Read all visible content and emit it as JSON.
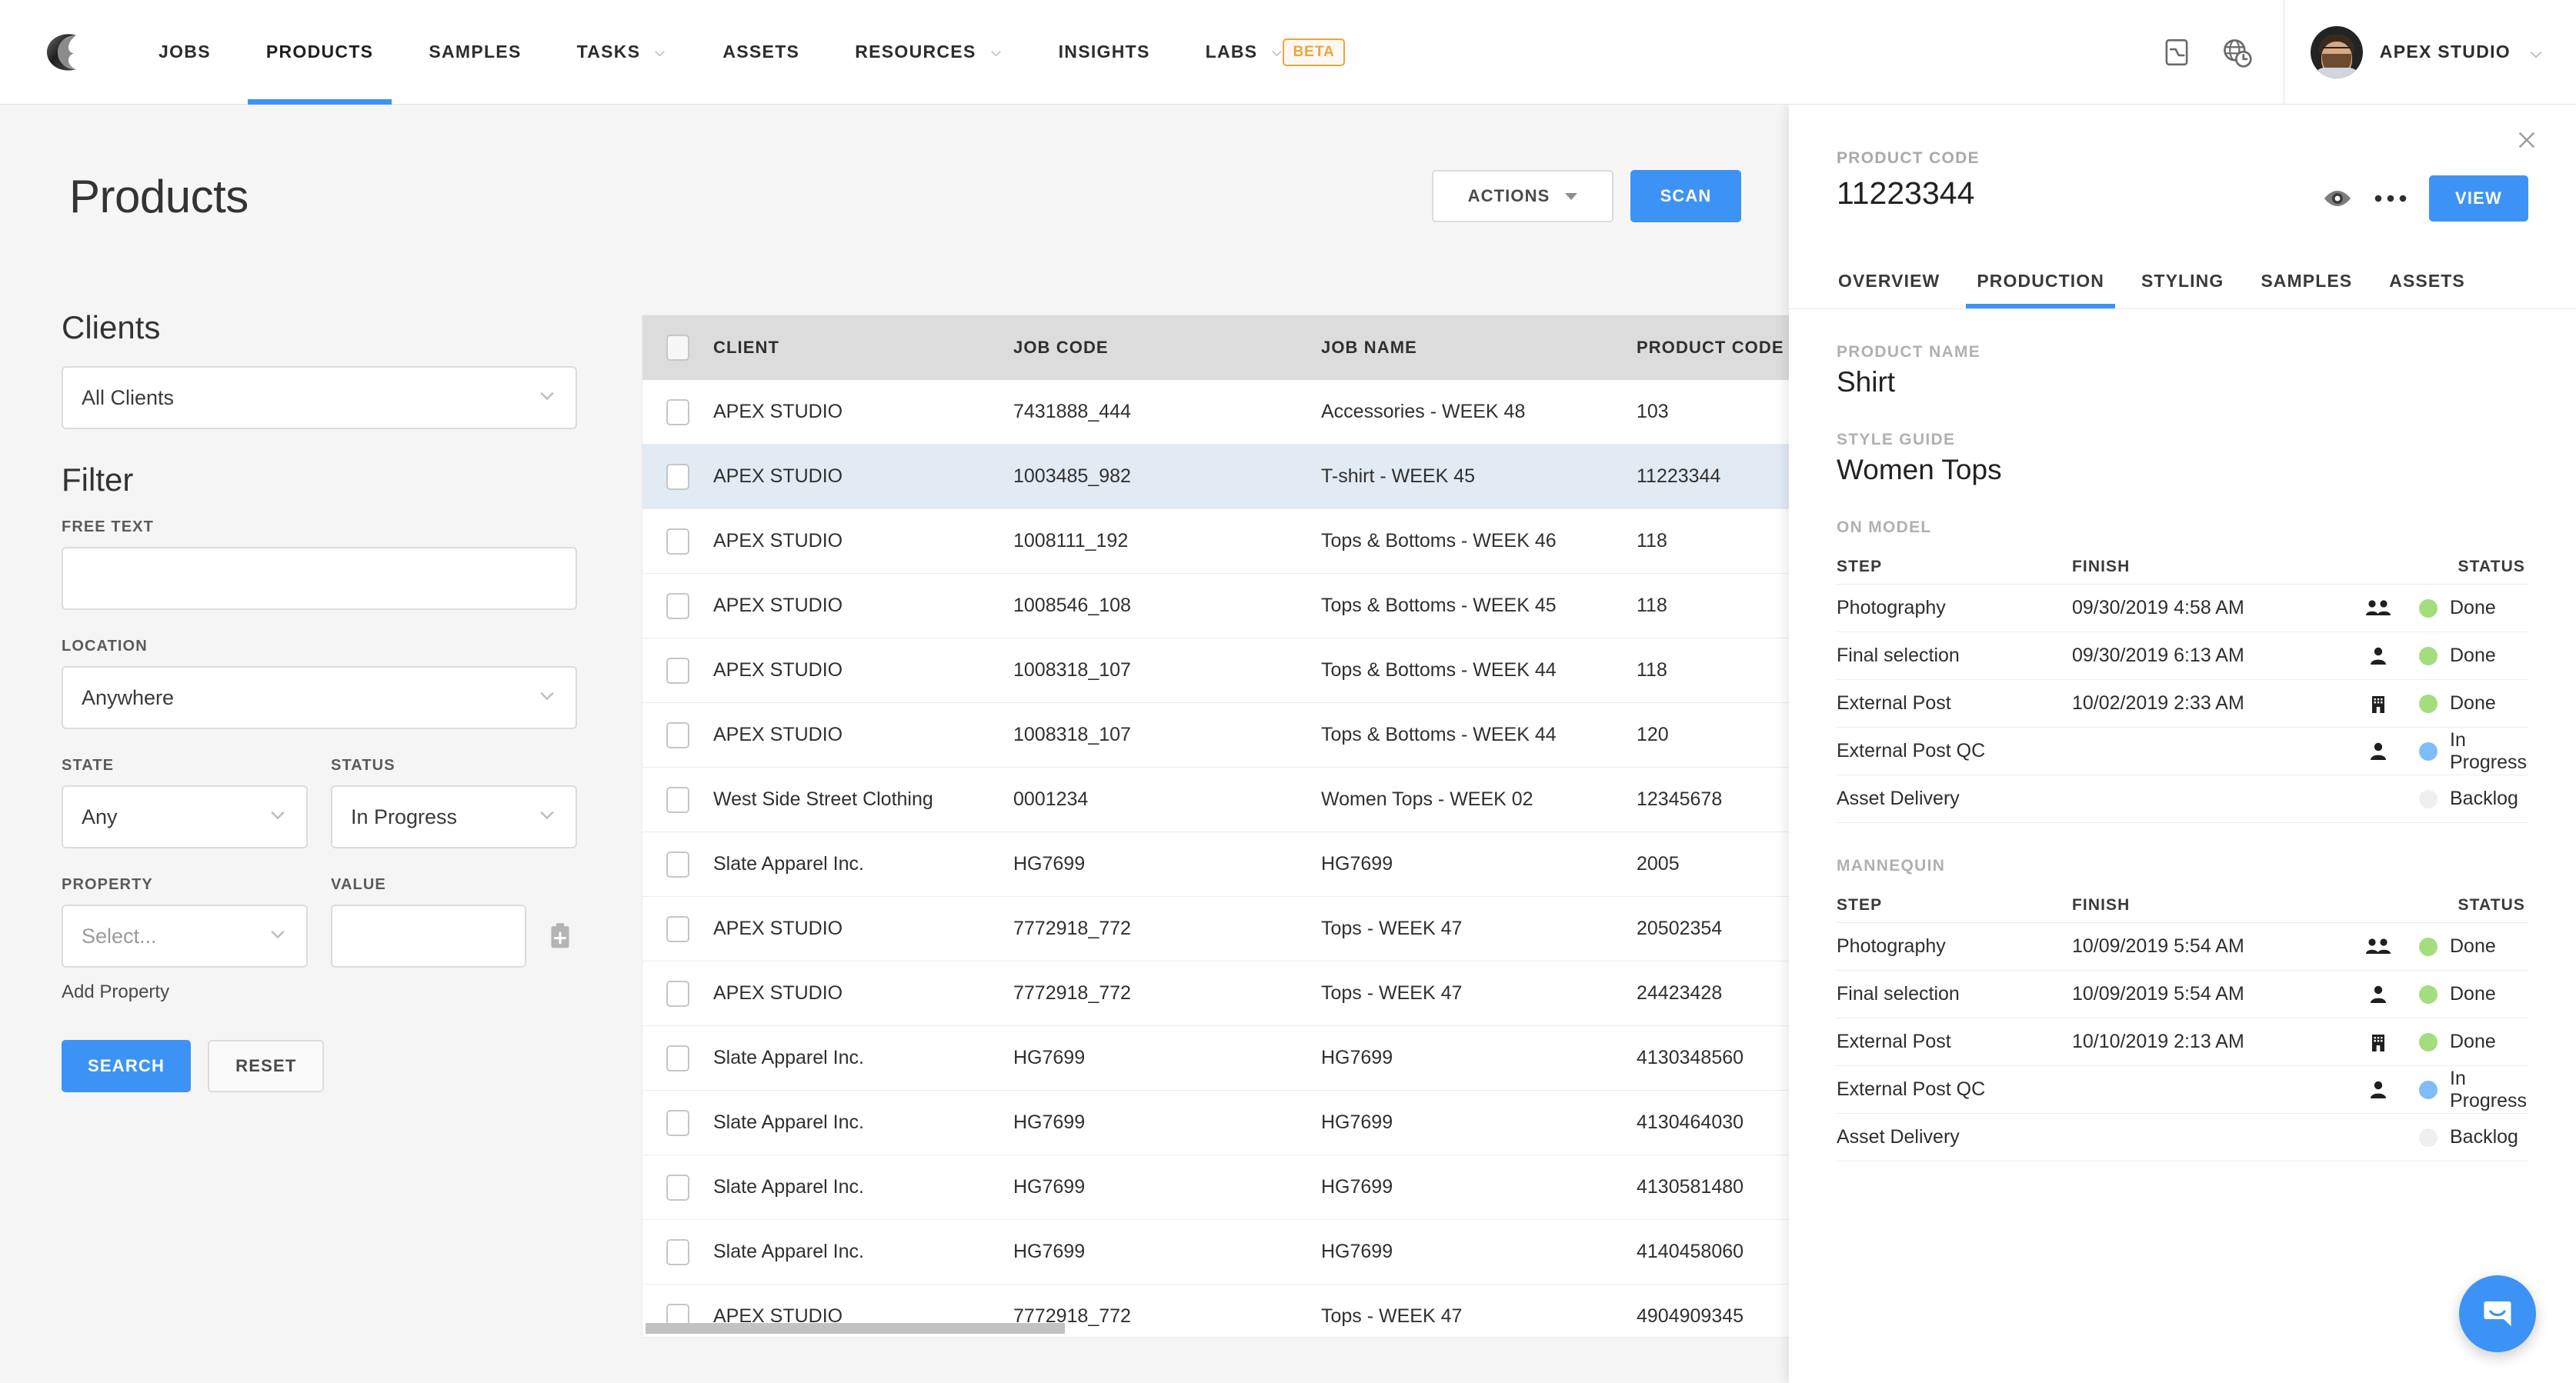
{
  "nav": {
    "logo_icon": "company-c-logo",
    "items": [
      {
        "label": "JOBS",
        "active": false,
        "dropdown": false,
        "badge": null
      },
      {
        "label": "PRODUCTS",
        "active": true,
        "dropdown": false,
        "badge": null
      },
      {
        "label": "SAMPLES",
        "active": false,
        "dropdown": false,
        "badge": null
      },
      {
        "label": "TASKS",
        "active": false,
        "dropdown": true,
        "badge": null
      },
      {
        "label": "ASSETS",
        "active": false,
        "dropdown": false,
        "badge": null
      },
      {
        "label": "RESOURCES",
        "active": false,
        "dropdown": true,
        "badge": null
      },
      {
        "label": "INSIGHTS",
        "active": false,
        "dropdown": false,
        "badge": null
      },
      {
        "label": "LABS",
        "active": false,
        "dropdown": true,
        "badge": "BETA"
      }
    ],
    "icons": [
      "shortcut-panel-icon",
      "globe-clock-icon"
    ],
    "user": {
      "name": "APEX STUDIO",
      "avatar": "user-avatar",
      "chevron": "chevron-down-icon"
    }
  },
  "page": {
    "title": "Products",
    "actions_label": "ACTIONS",
    "scan_label": "SCAN"
  },
  "sidebar": {
    "clients_heading": "Clients",
    "clients_value": "All Clients",
    "filter_heading": "Filter",
    "free_text_label": "FREE TEXT",
    "free_text_value": "",
    "free_text_placeholder": "",
    "location_label": "LOCATION",
    "location_value": "Anywhere",
    "state_label": "STATE",
    "state_value": "Any",
    "status_label": "STATUS",
    "status_value": "In Progress",
    "property_label": "PROPERTY",
    "property_value": "Select...",
    "value_label": "VALUE",
    "value_value": "",
    "add_property_link": "Add Property",
    "add_property_icon": "add-clipboard-icon",
    "search_label": "SEARCH",
    "reset_label": "RESET"
  },
  "table": {
    "columns": [
      "CLIENT",
      "JOB CODE",
      "JOB NAME",
      "PRODUCT CODE"
    ],
    "rows": [
      {
        "client": "APEX STUDIO",
        "job_code": "7431888_444",
        "job_name": "Accessories - WEEK 48",
        "product_code": "103",
        "selected": false
      },
      {
        "client": "APEX STUDIO",
        "job_code": "1003485_982",
        "job_name": "T-shirt - WEEK 45",
        "product_code": "11223344",
        "selected": true
      },
      {
        "client": "APEX STUDIO",
        "job_code": "1008111_192",
        "job_name": "Tops & Bottoms - WEEK 46",
        "product_code": "118",
        "selected": false
      },
      {
        "client": "APEX STUDIO",
        "job_code": "1008546_108",
        "job_name": "Tops & Bottoms - WEEK 45",
        "product_code": "118",
        "selected": false
      },
      {
        "client": "APEX STUDIO",
        "job_code": "1008318_107",
        "job_name": "Tops & Bottoms - WEEK 44",
        "product_code": "118",
        "selected": false
      },
      {
        "client": "APEX STUDIO",
        "job_code": "1008318_107",
        "job_name": "Tops & Bottoms - WEEK 44",
        "product_code": "120",
        "selected": false
      },
      {
        "client": "West Side Street Clothing",
        "job_code": "0001234",
        "job_name": "Women Tops - WEEK 02",
        "product_code": "12345678",
        "selected": false
      },
      {
        "client": "Slate Apparel Inc.",
        "job_code": "HG7699",
        "job_name": "HG7699",
        "product_code": "2005",
        "selected": false
      },
      {
        "client": "APEX STUDIO",
        "job_code": "7772918_772",
        "job_name": "Tops - WEEK 47",
        "product_code": "20502354",
        "selected": false
      },
      {
        "client": "APEX STUDIO",
        "job_code": "7772918_772",
        "job_name": "Tops - WEEK 47",
        "product_code": "24423428",
        "selected": false
      },
      {
        "client": "Slate Apparel Inc.",
        "job_code": "HG7699",
        "job_name": "HG7699",
        "product_code": "4130348560",
        "selected": false
      },
      {
        "client": "Slate Apparel Inc.",
        "job_code": "HG7699",
        "job_name": "HG7699",
        "product_code": "4130464030",
        "selected": false
      },
      {
        "client": "Slate Apparel Inc.",
        "job_code": "HG7699",
        "job_name": "HG7699",
        "product_code": "4130581480",
        "selected": false
      },
      {
        "client": "Slate Apparel Inc.",
        "job_code": "HG7699",
        "job_name": "HG7699",
        "product_code": "4140458060",
        "selected": false
      },
      {
        "client": "APEX STUDIO",
        "job_code": "7772918_772",
        "job_name": "Tops - WEEK 47",
        "product_code": "4904909345",
        "selected": false
      }
    ]
  },
  "detail": {
    "close_icon": "close-icon",
    "product_code_label": "PRODUCT CODE",
    "product_code_value": "11223344",
    "eye_icon": "eye-icon",
    "more_icon": "more-dots-icon",
    "view_label": "VIEW",
    "tabs": [
      {
        "label": "OVERVIEW",
        "active": false
      },
      {
        "label": "PRODUCTION",
        "active": true
      },
      {
        "label": "STYLING",
        "active": false
      },
      {
        "label": "SAMPLES",
        "active": false
      },
      {
        "label": "ASSETS",
        "active": false
      }
    ],
    "product_name_label": "PRODUCT NAME",
    "product_name_value": "Shirt",
    "style_guide_label": "STYLE GUIDE",
    "style_guide_value": "Women Tops",
    "step_columns": [
      "STEP",
      "FINISH",
      "STATUS"
    ],
    "sections": [
      {
        "title": "ON MODEL",
        "steps": [
          {
            "step": "Photography",
            "finish": "09/30/2019 4:58 AM",
            "who": "group-icon",
            "status": "Done",
            "status_color": "#a4dd7e"
          },
          {
            "step": "Final selection",
            "finish": "09/30/2019 6:13 AM",
            "who": "person-icon",
            "status": "Done",
            "status_color": "#a4dd7e"
          },
          {
            "step": "External Post",
            "finish": "10/02/2019 2:33 AM",
            "who": "building-icon",
            "status": "Done",
            "status_color": "#a4dd7e"
          },
          {
            "step": "External Post QC",
            "finish": "",
            "who": "person-icon",
            "status": "In Progress",
            "status_color": "#7fbdf6"
          },
          {
            "step": "Asset Delivery",
            "finish": "",
            "who": "",
            "status": "Backlog",
            "status_color": "#efefef"
          }
        ]
      },
      {
        "title": "MANNEQUIN",
        "steps": [
          {
            "step": "Photography",
            "finish": "10/09/2019 5:54 AM",
            "who": "group-icon",
            "status": "Done",
            "status_color": "#a4dd7e"
          },
          {
            "step": "Final selection",
            "finish": "10/09/2019 5:54 AM",
            "who": "person-icon",
            "status": "Done",
            "status_color": "#a4dd7e"
          },
          {
            "step": "External Post",
            "finish": "10/10/2019 2:13 AM",
            "who": "building-icon",
            "status": "Done",
            "status_color": "#a4dd7e"
          },
          {
            "step": "External Post QC",
            "finish": "",
            "who": "person-icon",
            "status": "In Progress",
            "status_color": "#7fbdf6"
          },
          {
            "step": "Asset Delivery",
            "finish": "",
            "who": "",
            "status": "Backlog",
            "status_color": "#efefef"
          }
        ]
      }
    ]
  },
  "intercom": {
    "icon": "intercom-chat-icon"
  },
  "colors": {
    "accent_blue": "#3d93f5",
    "beta_orange": "#eaa53c",
    "status_done": "#a4dd7e",
    "status_in_progress": "#7fbdf6",
    "status_backlog": "#efefef",
    "row_selected": "#e2eaf4",
    "table_header": "#dcdcdc"
  }
}
